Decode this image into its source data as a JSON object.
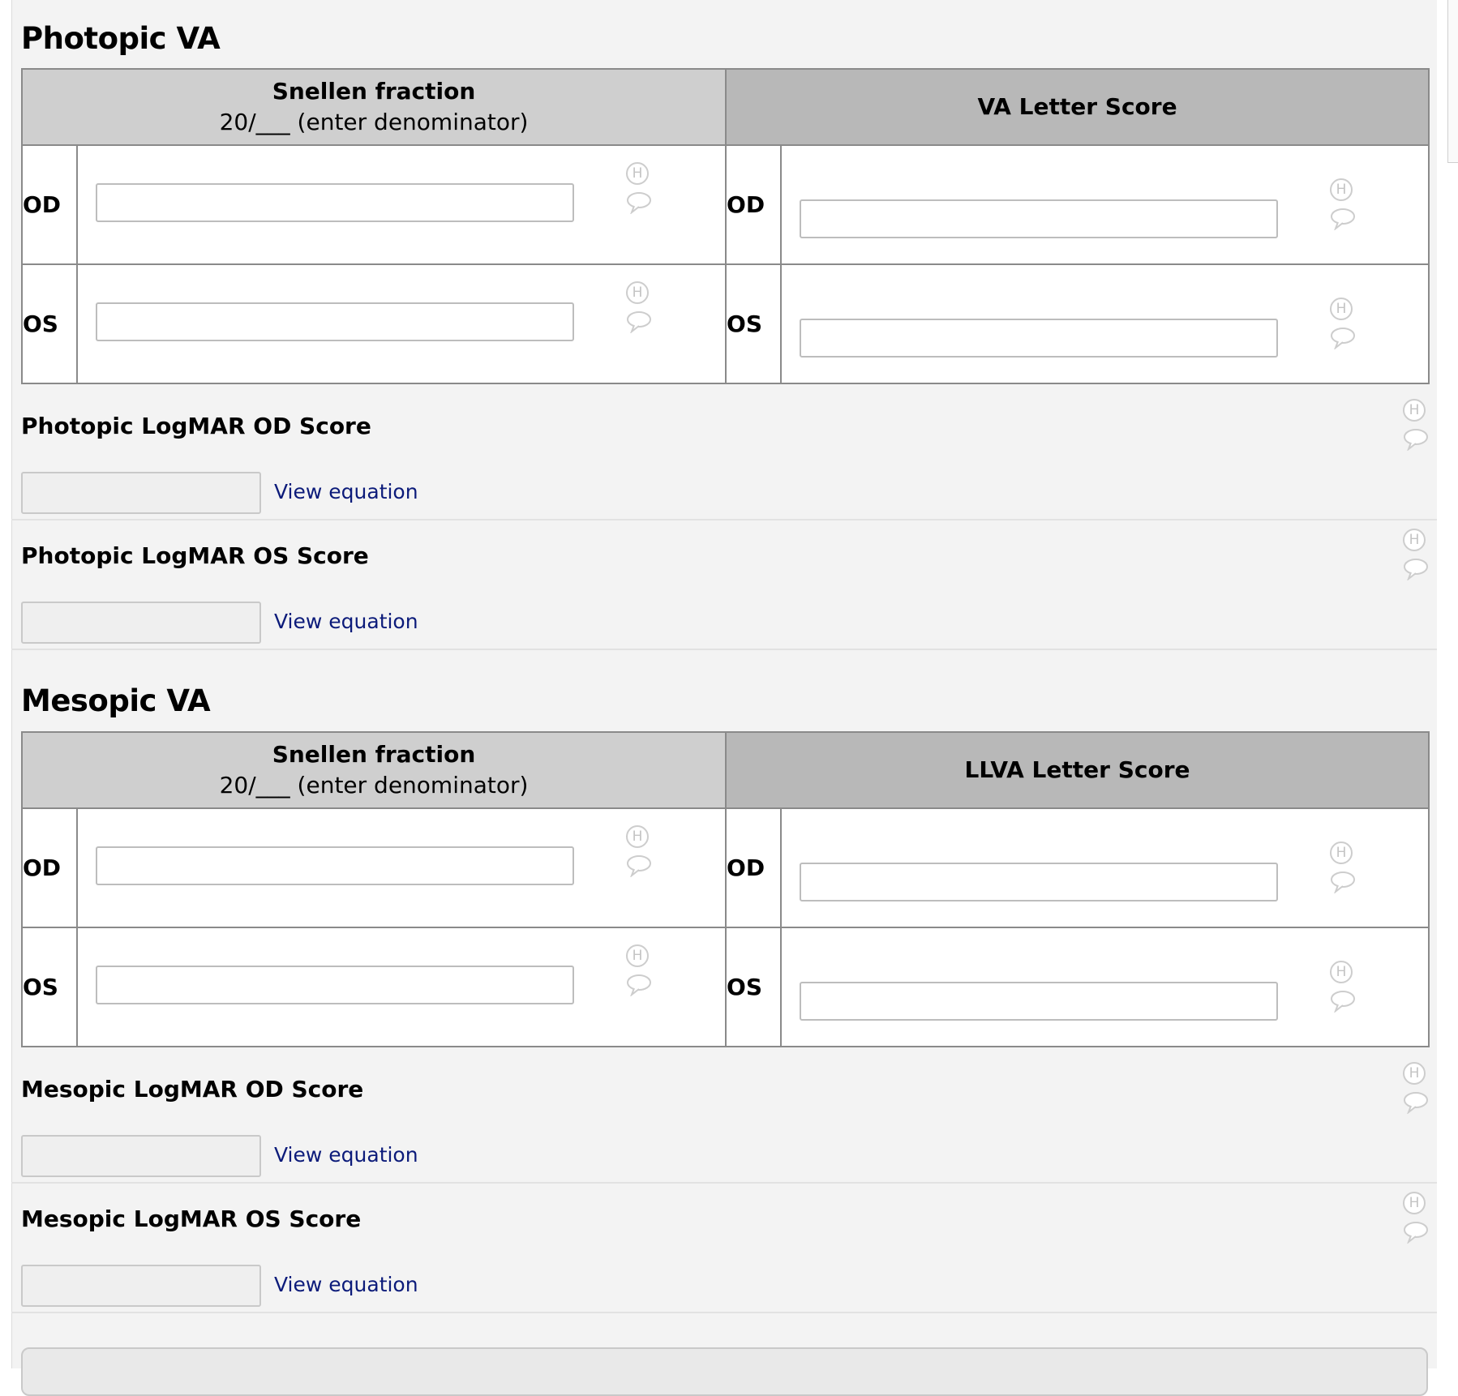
{
  "photopic": {
    "title": "Photopic VA",
    "snellen_header_bold": "Snellen fraction",
    "snellen_header_sub": "20/___ (enter denominator)",
    "letter_header": "VA Letter Score",
    "row_od": "OD",
    "row_os": "OS",
    "logmar_od_label": "Photopic LogMAR OD Score",
    "logmar_os_label": "Photopic LogMAR OS Score",
    "view_equation": "View equation"
  },
  "mesopic": {
    "title": "Mesopic VA",
    "snellen_header_bold": "Snellen fraction",
    "snellen_header_sub": "20/___ (enter denominator)",
    "letter_header": "LLVA Letter Score",
    "row_od": "OD",
    "row_os": "OS",
    "logmar_od_label": "Mesopic LogMAR OD Score",
    "logmar_os_label": "Mesopic LogMAR OS Score",
    "view_equation": "View equation"
  },
  "icons": {
    "history": "history-icon",
    "history_glyph": "H",
    "comment": "comment-icon"
  },
  "colors": {
    "link": "#0c1b7a",
    "panel_bg": "#f3f3f3",
    "header_light": "#cfcfcf",
    "header_dark": "#b8b8b8",
    "border": "#8a8a8a"
  }
}
